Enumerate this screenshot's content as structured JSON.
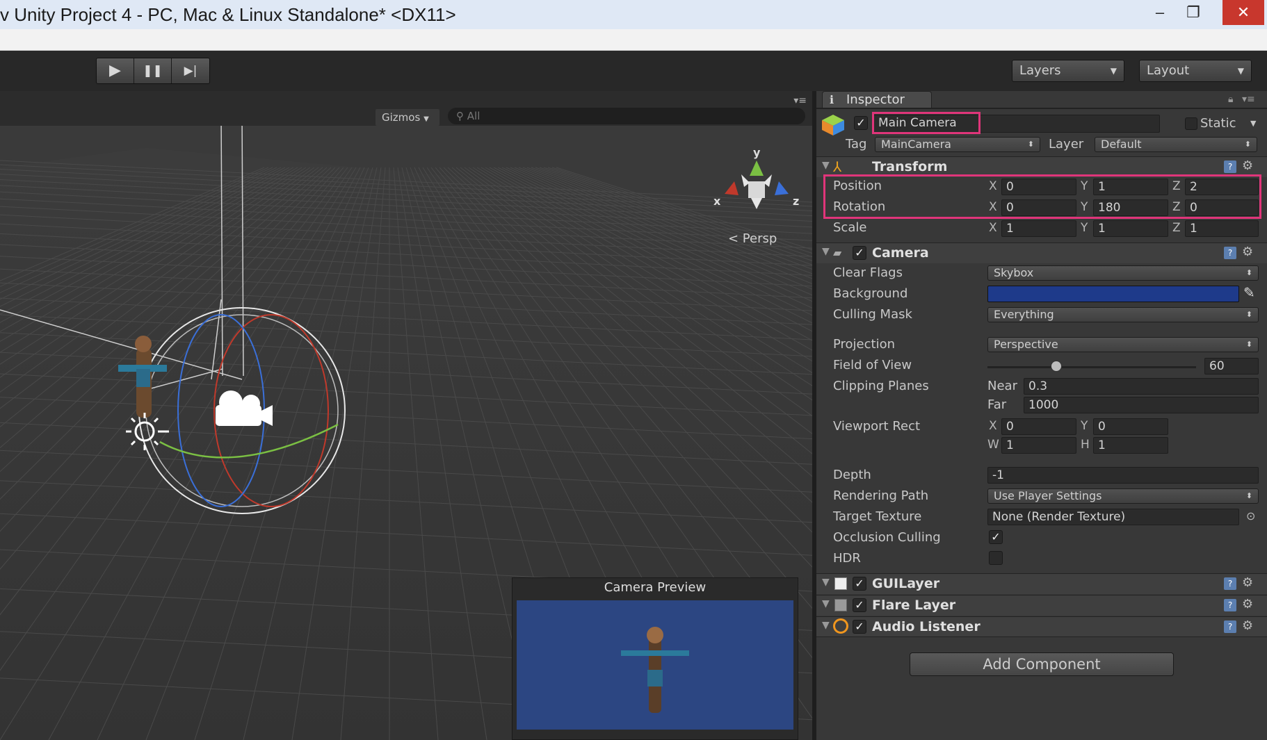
{
  "window": {
    "title": "v Unity Project 4 - PC, Mac & Linux Standalone* <DX11>",
    "minimize": "–",
    "maximize": "❐",
    "close": "✕"
  },
  "toolbar": {
    "play": "▶",
    "pause": "❚❚",
    "step": "▶|",
    "layers_label": "Layers",
    "layout_label": "Layout"
  },
  "scene": {
    "gizmos_label": "Gizmos",
    "search_placeholder": "All",
    "persp_label": "< Persp",
    "axis_y": "y",
    "axis_x": "x",
    "axis_z": "z",
    "camera_preview_title": "Camera Preview"
  },
  "inspector": {
    "tab_label": "Inspector",
    "object_active": true,
    "object_name": "Main Camera",
    "static_label": "Static",
    "tag_label": "Tag",
    "tag_value": "MainCamera",
    "layer_label": "Layer",
    "layer_value": "Default",
    "transform": {
      "title": "Transform",
      "position_label": "Position",
      "position": {
        "x": "0",
        "y": "1",
        "z": "2"
      },
      "rotation_label": "Rotation",
      "rotation": {
        "x": "0",
        "y": "180",
        "z": "0"
      },
      "scale_label": "Scale",
      "scale": {
        "x": "1",
        "y": "1",
        "z": "1"
      },
      "axis_x": "X",
      "axis_y": "Y",
      "axis_z": "Z"
    },
    "camera": {
      "title": "Camera",
      "clear_flags_label": "Clear Flags",
      "clear_flags_value": "Skybox",
      "background_label": "Background",
      "background_color": "#1e3a8a",
      "culling_mask_label": "Culling Mask",
      "culling_mask_value": "Everything",
      "projection_label": "Projection",
      "projection_value": "Perspective",
      "fov_label": "Field of View",
      "fov_value": "60",
      "fov_fraction": 0.33,
      "clipping_label": "Clipping Planes",
      "near_label": "Near",
      "near_value": "0.3",
      "far_label": "Far",
      "far_value": "1000",
      "viewport_label": "Viewport Rect",
      "vp_x_label": "X",
      "vp_x": "0",
      "vp_y_label": "Y",
      "vp_y": "0",
      "vp_w_label": "W",
      "vp_w": "1",
      "vp_h_label": "H",
      "vp_h": "1",
      "depth_label": "Depth",
      "depth_value": "-1",
      "rendering_path_label": "Rendering Path",
      "rendering_path_value": "Use Player Settings",
      "target_texture_label": "Target Texture",
      "target_texture_value": "None (Render Texture)",
      "occlusion_label": "Occlusion Culling",
      "occlusion_checked": true,
      "hdr_label": "HDR",
      "hdr_checked": false
    },
    "components": [
      {
        "name": "GUILayer",
        "enabled": true
      },
      {
        "name": "Flare Layer",
        "enabled": true
      },
      {
        "name": "Audio Listener",
        "enabled": true
      }
    ],
    "add_component_label": "Add Component"
  },
  "colors": {
    "highlight": "#e0357a",
    "preview_bg": "#2c4682"
  }
}
